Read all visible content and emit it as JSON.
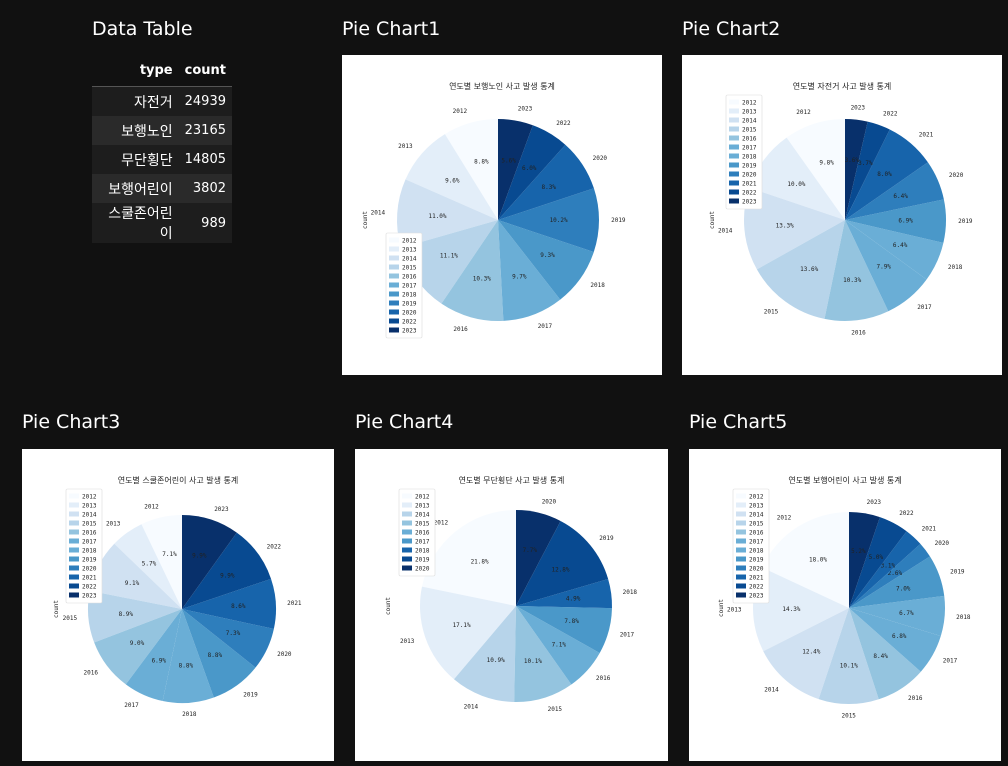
{
  "table": {
    "heading": "Data Table",
    "columns": [
      "type",
      "count"
    ],
    "rows": [
      {
        "type": "자전거",
        "count": "24939"
      },
      {
        "type": "보행노인",
        "count": "23165"
      },
      {
        "type": "무단횡단",
        "count": "14805"
      },
      {
        "type": "보행어린이",
        "count": "3802"
      },
      {
        "type": "스쿨존어린이",
        "count": "989"
      }
    ]
  },
  "colors": {
    "background": "#111111",
    "blues": [
      "#f7fbff",
      "#e3eef9",
      "#d0e1f2",
      "#b7d4ea",
      "#94c4df",
      "#6aaed6",
      "#4a98c9",
      "#2e7ebc",
      "#1764ab",
      "#084a91",
      "#08306b"
    ]
  },
  "chart_data": [
    {
      "heading": "Pie Chart1",
      "type": "pie",
      "title": "연도별 보행노인 사고 발생 통계",
      "ylabel": "count",
      "legend": "lower-left",
      "categories": [
        "2012",
        "2013",
        "2014",
        "2015",
        "2016",
        "2017",
        "2018",
        "2019",
        "2020",
        "2022",
        "2023"
      ],
      "values": [
        8.8,
        9.6,
        11.0,
        11.1,
        10.3,
        9.7,
        9.3,
        10.2,
        8.3,
        6.0,
        5.6
      ],
      "pct_labels": [
        "8.8%",
        "9.6%",
        "11.0%",
        "11.1%",
        "10.3%",
        "9.7%",
        "9.3%",
        "10.2%",
        "8.3%",
        "6.0%",
        "5.6%"
      ]
    },
    {
      "heading": "Pie Chart2",
      "type": "pie",
      "title": "연도별 자전거 사고 발생 통계",
      "ylabel": "count",
      "legend": "upper-left",
      "categories": [
        "2012",
        "2013",
        "2014",
        "2015",
        "2016",
        "2017",
        "2018",
        "2019",
        "2020",
        "2021",
        "2022",
        "2023"
      ],
      "values": [
        9.8,
        10.0,
        13.3,
        13.6,
        10.3,
        7.9,
        6.4,
        6.9,
        6.4,
        8.0,
        3.7,
        3.6
      ],
      "pct_labels": [
        "9.8%",
        "10.0%",
        "13.3%",
        "13.6%",
        "10.3%",
        "7.9%",
        "6.4%",
        "6.9%",
        "6.4%",
        "8.0%",
        "3.7%",
        "3.6%"
      ]
    },
    {
      "heading": "Pie Chart3",
      "type": "pie",
      "title": "연도별 스쿨존어린이 사고 발생 통계",
      "ylabel": "count",
      "legend": "upper-left",
      "categories": [
        "2012",
        "2013",
        "2014",
        "2015",
        "2016",
        "2017",
        "2018",
        "2019",
        "2020",
        "2021",
        "2022",
        "2023"
      ],
      "values": [
        7.1,
        5.7,
        9.1,
        8.9,
        9.0,
        6.9,
        8.8,
        8.8,
        7.3,
        8.6,
        9.9,
        9.9
      ],
      "pct_labels": [
        "7.1%",
        "5.7%",
        "9.1%",
        "8.9%",
        "9.0%",
        "6.9%",
        "8.8%",
        "8.8%",
        "7.3%",
        "8.6%",
        "9.9%",
        "9.9%"
      ]
    },
    {
      "heading": "Pie Chart4",
      "type": "pie",
      "title": "연도별 무단횡단 사고 발생 통계",
      "ylabel": "count",
      "legend": "upper-left",
      "categories": [
        "2012",
        "2013",
        "2014",
        "2015",
        "2016",
        "2017",
        "2018",
        "2019",
        "2020"
      ],
      "values": [
        21.8,
        17.1,
        10.9,
        10.1,
        7.1,
        7.8,
        4.9,
        12.8,
        7.7
      ],
      "pct_labels": [
        "21.8%",
        "17.1%",
        "10.9%",
        "10.1%",
        "7.1%",
        "7.8%",
        "4.9%",
        "12.8%",
        "7.7%"
      ]
    },
    {
      "heading": "Pie Chart5",
      "type": "pie",
      "title": "연도별 보행어린이 사고 발생 통계",
      "ylabel": "count",
      "legend": "upper-left",
      "categories": [
        "2012",
        "2013",
        "2014",
        "2015",
        "2016",
        "2017",
        "2018",
        "2019",
        "2020",
        "2021",
        "2022",
        "2023"
      ],
      "values": [
        18.0,
        14.3,
        12.4,
        10.1,
        8.4,
        6.8,
        6.7,
        7.0,
        2.6,
        3.1,
        5.0,
        5.2
      ],
      "pct_labels": [
        "18.0%",
        "14.3%",
        "12.4%",
        "10.1%",
        "8.4%",
        "6.8%",
        "6.7%",
        "7.0%",
        "2.6%",
        "3.1%",
        "5.0%",
        "5.2%"
      ]
    }
  ]
}
